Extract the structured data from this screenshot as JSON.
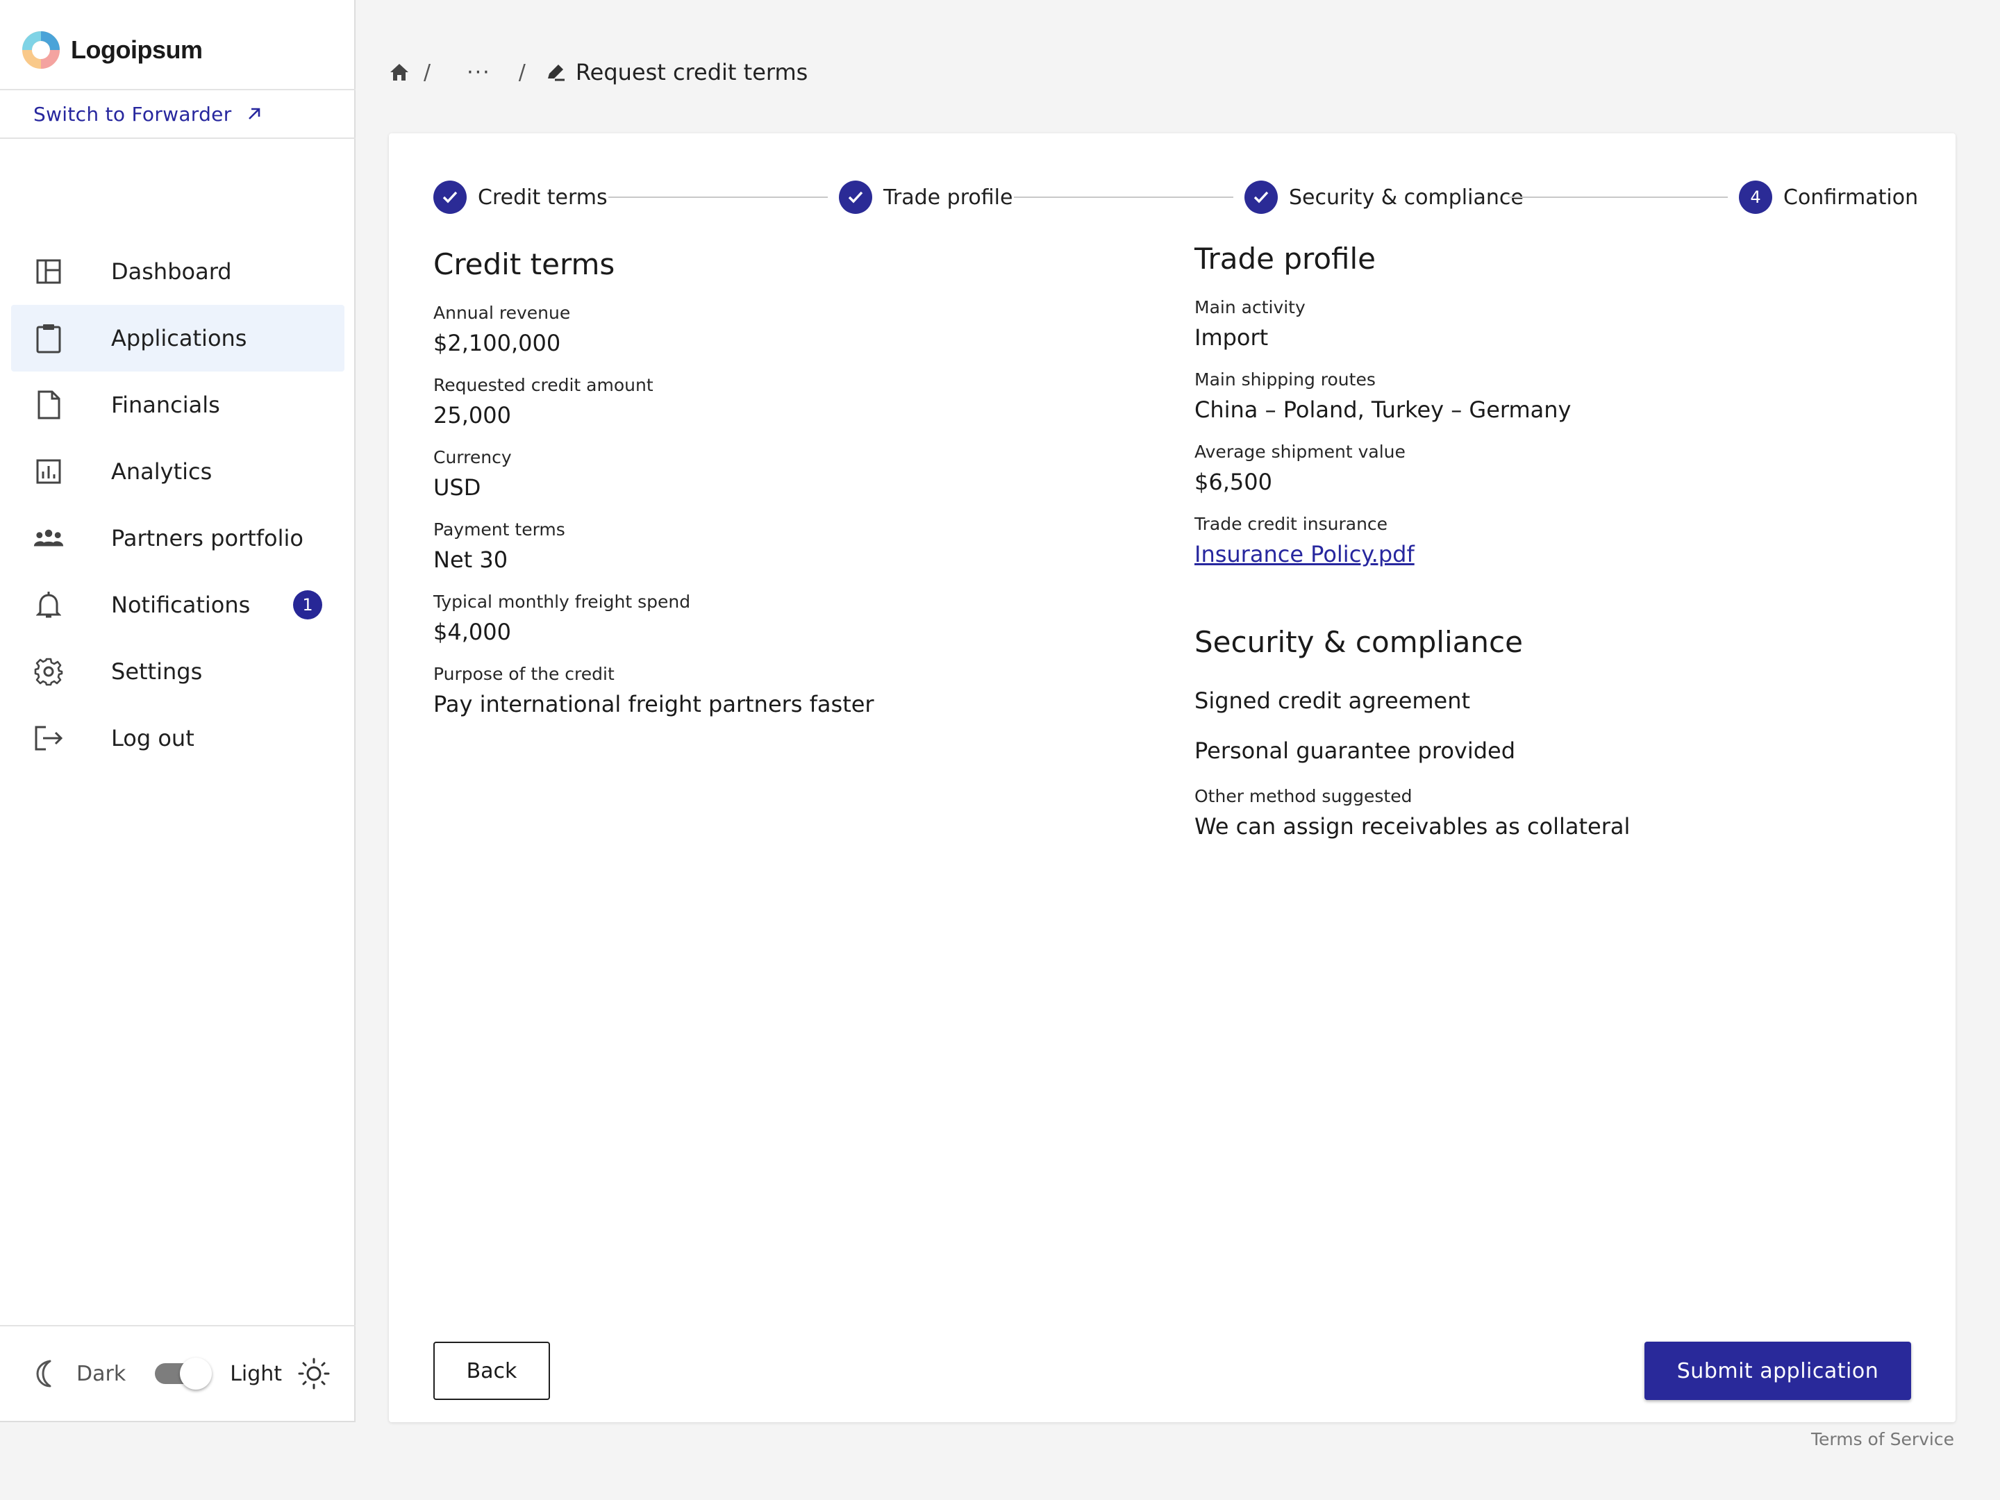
{
  "brand": {
    "name": "Logoipsum"
  },
  "sidebar": {
    "switch_label": "Switch to Forwarder",
    "items": [
      {
        "id": "dashboard",
        "label": "Dashboard",
        "icon": "dashboard-icon"
      },
      {
        "id": "applications",
        "label": "Applications",
        "icon": "clipboard-icon",
        "active": true
      },
      {
        "id": "financials",
        "label": "Financials",
        "icon": "document-icon"
      },
      {
        "id": "analytics",
        "label": "Analytics",
        "icon": "bar-chart-icon"
      },
      {
        "id": "partners",
        "label": "Partners portfolio",
        "icon": "group-icon"
      },
      {
        "id": "notifications",
        "label": "Notifications",
        "icon": "bell-icon",
        "badge": "1"
      },
      {
        "id": "settings",
        "label": "Settings",
        "icon": "gear-icon"
      },
      {
        "id": "logout",
        "label": "Log out",
        "icon": "logout-icon"
      }
    ],
    "theme": {
      "dark_label": "Dark",
      "light_label": "Light",
      "mode": "light"
    }
  },
  "breadcrumb": {
    "home_icon": "home-icon",
    "ellipsis": "···",
    "current": "Request credit terms",
    "current_icon": "edit-icon"
  },
  "stepper": {
    "steps": [
      {
        "label": "Credit terms",
        "status": "done"
      },
      {
        "label": "Trade profile",
        "status": "done"
      },
      {
        "label": "Security & compliance",
        "status": "done"
      },
      {
        "label": "Confirmation",
        "status": "current",
        "number": "4"
      }
    ]
  },
  "credit_terms": {
    "title": "Credit terms",
    "fields": [
      {
        "label": "Annual revenue",
        "value": "$2,100,000"
      },
      {
        "label": "Requested credit amount",
        "value": "25,000"
      },
      {
        "label": "Currency",
        "value": "USD"
      },
      {
        "label": "Payment terms",
        "value": "Net 30"
      },
      {
        "label": "Typical monthly freight spend",
        "value": "$4,000"
      },
      {
        "label": "Purpose of the credit",
        "value": "Pay international freight partners faster"
      }
    ]
  },
  "trade_profile": {
    "title": "Trade profile",
    "fields": [
      {
        "label": "Main activity",
        "value": "Import"
      },
      {
        "label": "Main shipping routes",
        "value": "China – Poland, Turkey – Germany"
      },
      {
        "label": "Average shipment value",
        "value": "$6,500"
      },
      {
        "label": "Trade credit insurance",
        "value": "Insurance Policy.pdf"
      }
    ]
  },
  "security": {
    "title": "Security & compliance",
    "items": [
      "Signed credit agreement",
      "Personal guarantee provided"
    ],
    "other": {
      "label": "Other method suggested",
      "value": "We can assign receivables as collateral"
    }
  },
  "actions": {
    "back_label": "Back",
    "submit_label": "Submit application"
  },
  "footer": {
    "terms_label": "Terms of Service"
  },
  "colors": {
    "primary": "#29299a",
    "active_bg": "#edf3fc",
    "page_bg": "#f4f4f4"
  }
}
